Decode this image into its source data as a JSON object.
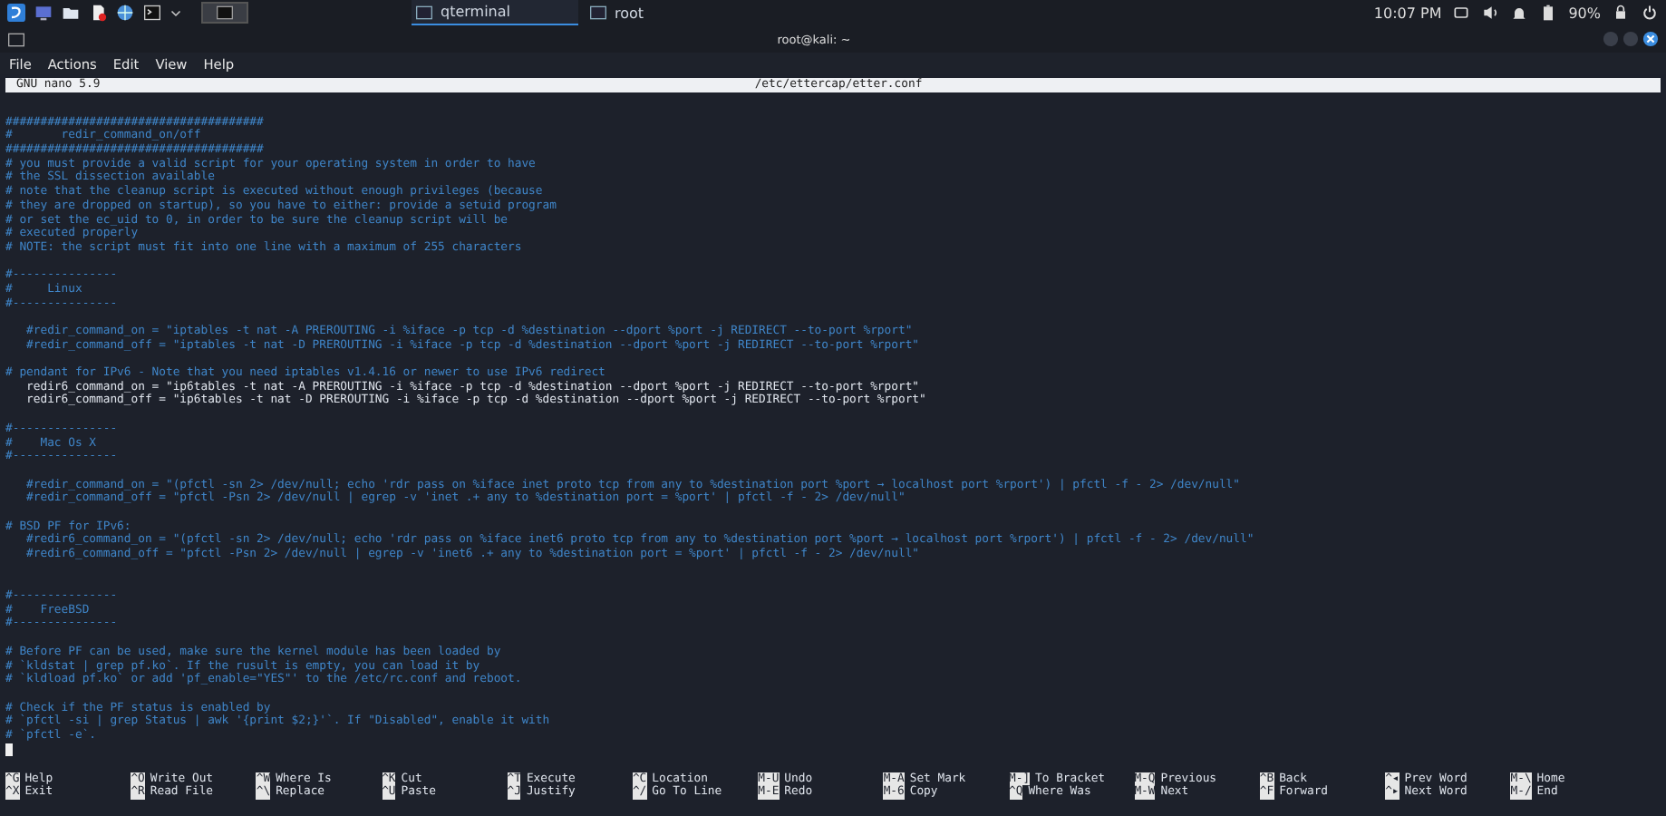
{
  "taskbar": {
    "tasks": [
      {
        "label": "qterminal",
        "selected": true
      },
      {
        "label": "root",
        "selected": false
      }
    ],
    "clock": "10:07 PM",
    "battery": "90%"
  },
  "window": {
    "title": "root@kali: ~"
  },
  "menu": [
    "File",
    "Actions",
    "Edit",
    "View",
    "Help"
  ],
  "nano": {
    "version": "GNU nano 5.9",
    "filename": "/etc/ettercap/etter.conf"
  },
  "lines": [
    {
      "kind": "comment",
      "text": "#####################################"
    },
    {
      "kind": "comment",
      "text": "#       redir_command_on/off"
    },
    {
      "kind": "comment",
      "text": "#####################################"
    },
    {
      "kind": "comment",
      "text": "# you must provide a valid script for your operating system in order to have"
    },
    {
      "kind": "comment",
      "text": "# the SSL dissection available"
    },
    {
      "kind": "comment",
      "text": "# note that the cleanup script is executed without enough privileges (because"
    },
    {
      "kind": "comment",
      "text": "# they are dropped on startup), so you have to either: provide a setuid program"
    },
    {
      "kind": "comment",
      "text": "# or set the ec_uid to 0, in order to be sure the cleanup script will be"
    },
    {
      "kind": "comment",
      "text": "# executed properly"
    },
    {
      "kind": "comment",
      "text": "# NOTE: the script must fit into one line with a maximum of 255 characters"
    },
    {
      "kind": "blank"
    },
    {
      "kind": "comment",
      "text": "#---------------"
    },
    {
      "kind": "comment",
      "text": "#     Linux"
    },
    {
      "kind": "comment",
      "text": "#---------------"
    },
    {
      "kind": "blank"
    },
    {
      "kind": "comment",
      "text": "   #redir_command_on = \"iptables -t nat -A PREROUTING -i %iface -p tcp -d %destination --dport %port -j REDIRECT --to-port %rport\""
    },
    {
      "kind": "comment",
      "text": "   #redir_command_off = \"iptables -t nat -D PREROUTING -i %iface -p tcp -d %destination --dport %port -j REDIRECT --to-port %rport\""
    },
    {
      "kind": "blank"
    },
    {
      "kind": "comment",
      "text": "# pendant for IPv6 - Note that you need iptables v1.4.16 or newer to use IPv6 redirect"
    },
    {
      "kind": "code",
      "text": "   redir6_command_on = \"ip6tables -t nat -A PREROUTING -i %iface -p tcp -d %destination --dport %port -j REDIRECT --to-port %rport\""
    },
    {
      "kind": "code",
      "text": "   redir6_command_off = \"ip6tables -t nat -D PREROUTING -i %iface -p tcp -d %destination --dport %port -j REDIRECT --to-port %rport\""
    },
    {
      "kind": "blank"
    },
    {
      "kind": "comment",
      "text": "#---------------"
    },
    {
      "kind": "comment",
      "text": "#    Mac Os X"
    },
    {
      "kind": "comment",
      "text": "#---------------"
    },
    {
      "kind": "blank"
    },
    {
      "kind": "comment",
      "text": "   #redir_command_on = \"(pfctl -sn 2> /dev/null; echo 'rdr pass on %iface inet proto tcp from any to %destination port %port → localhost port %rport') | pfctl -f - 2> /dev/null\""
    },
    {
      "kind": "comment",
      "text": "   #redir_command_off = \"pfctl -Psn 2> /dev/null | egrep -v 'inet .+ any to %destination port = %port' | pfctl -f - 2> /dev/null\""
    },
    {
      "kind": "blank"
    },
    {
      "kind": "comment",
      "text": "# BSD PF for IPv6:"
    },
    {
      "kind": "comment",
      "text": "   #redir6_command_on = \"(pfctl -sn 2> /dev/null; echo 'rdr pass on %iface inet6 proto tcp from any to %destination port %port → localhost port %rport') | pfctl -f - 2> /dev/null\""
    },
    {
      "kind": "comment",
      "text": "   #redir6_command_off = \"pfctl -Psn 2> /dev/null | egrep -v 'inet6 .+ any to %destination port = %port' | pfctl -f - 2> /dev/null\""
    },
    {
      "kind": "blank"
    },
    {
      "kind": "blank"
    },
    {
      "kind": "comment",
      "text": "#---------------"
    },
    {
      "kind": "comment",
      "text": "#    FreeBSD"
    },
    {
      "kind": "comment",
      "text": "#---------------"
    },
    {
      "kind": "blank"
    },
    {
      "kind": "comment",
      "text": "# Before PF can be used, make sure the kernel module has been loaded by"
    },
    {
      "kind": "comment",
      "text": "# `kldstat | grep pf.ko`. If the rusult is empty, you can load it by"
    },
    {
      "kind": "comment",
      "text": "# `kldload pf.ko` or add 'pf_enable=\"YES\"' to the /etc/rc.conf and reboot."
    },
    {
      "kind": "blank"
    },
    {
      "kind": "comment",
      "text": "# Check if the PF status is enabled by"
    },
    {
      "kind": "comment",
      "text": "# `pfctl -si | grep Status | awk '{print $2;}'`. If \"Disabled\", enable it with"
    },
    {
      "kind": "comment",
      "text": "# `pfctl -e`."
    },
    {
      "kind": "cursor"
    }
  ],
  "shortcuts": [
    [
      {
        "key": "^G",
        "label": "Help"
      },
      {
        "key": "^X",
        "label": "Exit"
      }
    ],
    [
      {
        "key": "^O",
        "label": "Write Out"
      },
      {
        "key": "^R",
        "label": "Read File"
      }
    ],
    [
      {
        "key": "^W",
        "label": "Where Is"
      },
      {
        "key": "^\\",
        "label": "Replace"
      }
    ],
    [
      {
        "key": "^K",
        "label": "Cut"
      },
      {
        "key": "^U",
        "label": "Paste"
      }
    ],
    [
      {
        "key": "^T",
        "label": "Execute"
      },
      {
        "key": "^J",
        "label": "Justify"
      }
    ],
    [
      {
        "key": "^C",
        "label": "Location"
      },
      {
        "key": "^/",
        "label": "Go To Line"
      }
    ],
    [
      {
        "key": "M-U",
        "label": "Undo"
      },
      {
        "key": "M-E",
        "label": "Redo"
      }
    ],
    [
      {
        "key": "M-A",
        "label": "Set Mark"
      },
      {
        "key": "M-6",
        "label": "Copy"
      }
    ],
    [
      {
        "key": "M-]",
        "label": "To Bracket"
      },
      {
        "key": "^Q",
        "label": "Where Was"
      }
    ],
    [
      {
        "key": "M-Q",
        "label": "Previous"
      },
      {
        "key": "M-W",
        "label": "Next"
      }
    ],
    [
      {
        "key": "^B",
        "label": "Back"
      },
      {
        "key": "^F",
        "label": "Forward"
      }
    ],
    [
      {
        "key": "^◂",
        "label": "Prev Word"
      },
      {
        "key": "^▸",
        "label": "Next Word"
      }
    ],
    [
      {
        "key": "M-\\",
        "label": "Home"
      },
      {
        "key": "M-/",
        "label": "End"
      }
    ]
  ]
}
